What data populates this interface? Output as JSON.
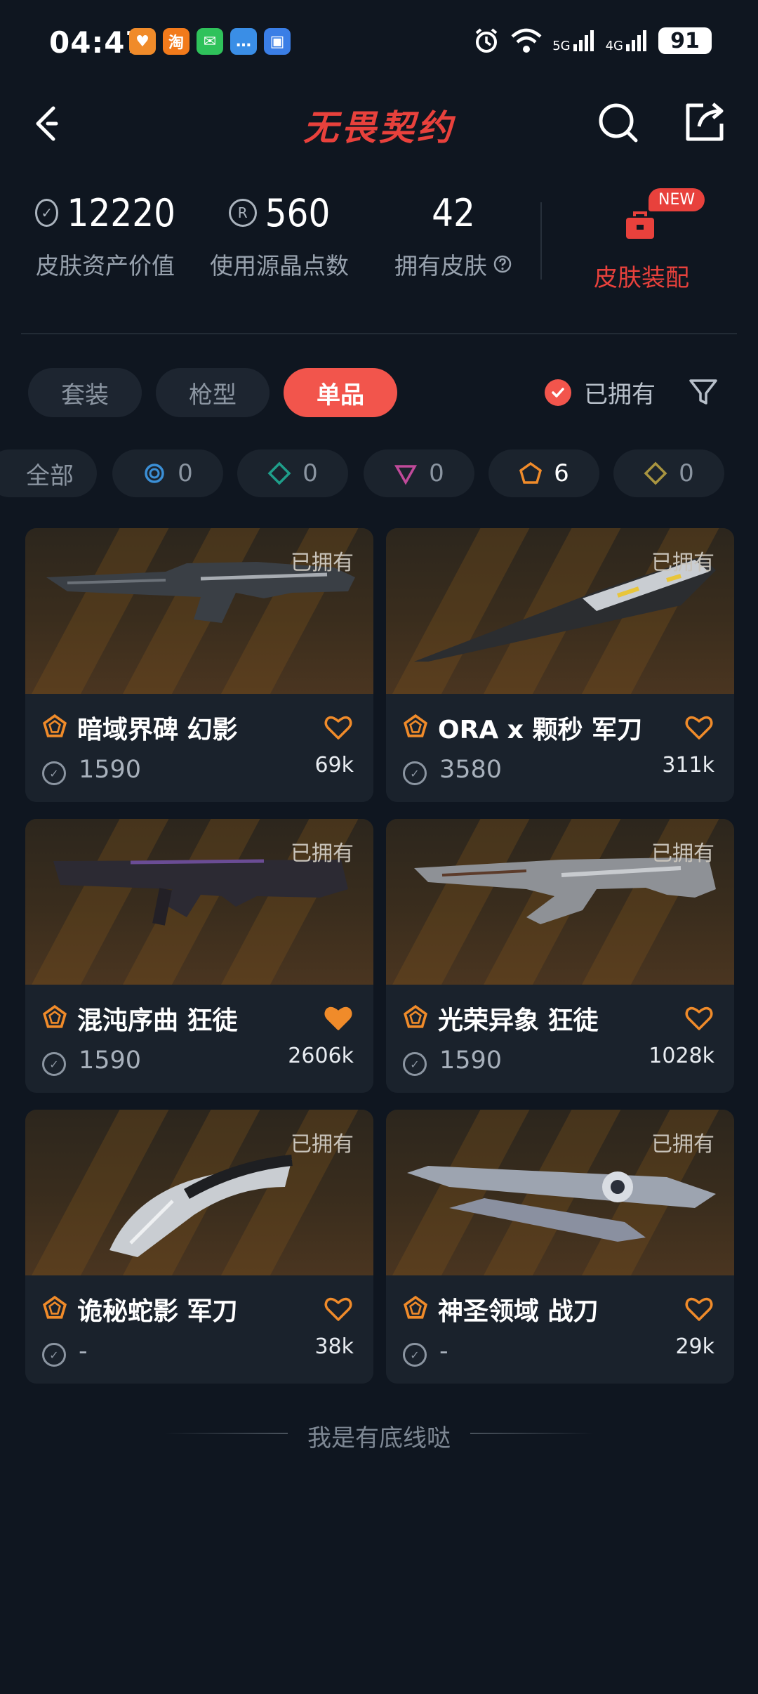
{
  "status": {
    "time": "04:47",
    "network1": "5G",
    "network2": "4G",
    "battery": "91",
    "apps": [
      {
        "name": "heart-app-icon",
        "glyph": "♥",
        "color": "#f08b2a"
      },
      {
        "name": "taobao-icon",
        "glyph": "淘",
        "color": "#f27a1b"
      },
      {
        "name": "wechat-icon",
        "glyph": "✉",
        "color": "#2fc25b"
      },
      {
        "name": "message-icon",
        "glyph": "…",
        "color": "#3a8ee6"
      },
      {
        "name": "store-icon",
        "glyph": "▣",
        "color": "#3a7ee6"
      }
    ]
  },
  "header": {
    "title": "无畏契约"
  },
  "stats": {
    "asset_value": "12220",
    "asset_label": "皮肤资产价值",
    "radianite": "560",
    "radianite_label": "使用源晶点数",
    "owned": "42",
    "owned_label": "拥有皮肤",
    "new_badge": "NEW",
    "loadout_label": "皮肤装配"
  },
  "tabs": [
    {
      "label": "套装",
      "active": false
    },
    {
      "label": "枪型",
      "active": false
    },
    {
      "label": "单品",
      "active": true
    }
  ],
  "owned_filter": {
    "label": "已拥有",
    "checked": true
  },
  "tiers": [
    {
      "label": "全部",
      "count": "",
      "icon": "all",
      "color": "#8b95a1",
      "selected": false
    },
    {
      "label": "",
      "count": "0",
      "icon": "select-tier-icon",
      "color": "#3b8fd6",
      "selected": false
    },
    {
      "label": "",
      "count": "0",
      "icon": "deluxe-tier-icon",
      "color": "#1f9e8a",
      "selected": false
    },
    {
      "label": "",
      "count": "0",
      "icon": "premium-tier-icon",
      "color": "#c04a9a",
      "selected": false
    },
    {
      "label": "",
      "count": "6",
      "icon": "exclusive-tier-icon",
      "color": "#f08b2a",
      "selected": true
    },
    {
      "label": "",
      "count": "0",
      "icon": "ultra-tier-icon",
      "color": "#a89440",
      "selected": false
    }
  ],
  "cards": [
    {
      "name": "暗域界碑 幻影",
      "price": "1590",
      "likes": "69k",
      "owned": "已拥有",
      "liked": false
    },
    {
      "name": "ORA x 颗秒 军刀",
      "price": "3580",
      "likes": "311k",
      "owned": "已拥有",
      "liked": false
    },
    {
      "name": "混沌序曲 狂徒",
      "price": "1590",
      "likes": "2606k",
      "owned": "已拥有",
      "liked": true
    },
    {
      "name": "光荣异象 狂徒",
      "price": "1590",
      "likes": "1028k",
      "owned": "已拥有",
      "liked": false
    },
    {
      "name": "诡秘蛇影 军刀",
      "price": "-",
      "likes": "38k",
      "owned": "已拥有",
      "liked": false
    },
    {
      "name": "神圣领域 战刀",
      "price": "-",
      "likes": "29k",
      "owned": "已拥有",
      "liked": false
    }
  ],
  "footer": "我是有底线哒"
}
